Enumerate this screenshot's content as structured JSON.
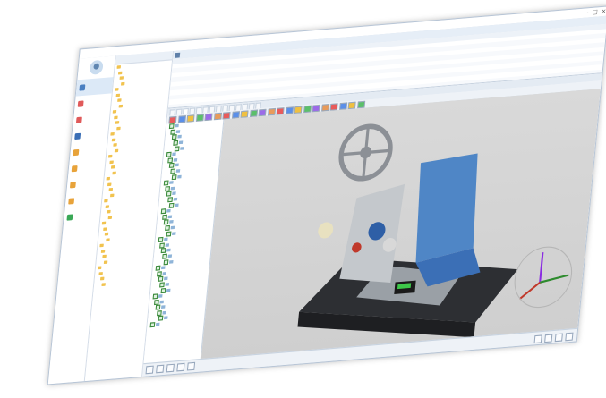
{
  "window": {
    "title": "",
    "controls": [
      "—",
      "□",
      "×"
    ]
  },
  "sidebar": {
    "items": [
      {
        "label": "",
        "icon": "document-icon",
        "color": "#4a7fc1"
      },
      {
        "label": "",
        "icon": "folder-icon",
        "color": "#e05a5a"
      },
      {
        "label": "",
        "icon": "folder-icon",
        "color": "#e05a5a"
      },
      {
        "label": "",
        "icon": "cube-icon",
        "color": "#3b6fb6"
      },
      {
        "label": "",
        "icon": "folder-icon",
        "color": "#e8a33a"
      },
      {
        "label": "",
        "icon": "folder-icon",
        "color": "#e8a33a"
      },
      {
        "label": "",
        "icon": "folder-icon",
        "color": "#e8a33a"
      },
      {
        "label": "",
        "icon": "folder-icon",
        "color": "#e8a33a"
      },
      {
        "label": "",
        "icon": "folder-icon",
        "color": "#3aa856"
      }
    ]
  },
  "tree": {
    "header": "",
    "rows": 40
  },
  "main": {
    "header": "",
    "grid": {
      "rows": 10,
      "cols": 12
    }
  },
  "viewer": {
    "tabs": [
      "",
      "",
      "",
      "",
      "",
      "",
      "",
      "",
      "",
      "",
      "",
      "",
      "",
      ""
    ],
    "toolbar_count": 22,
    "part_rows": 36
  },
  "footer": {
    "buttons": [
      "",
      "",
      "",
      "",
      ""
    ],
    "right_buttons": [
      "",
      "",
      "",
      ""
    ]
  },
  "colors": {
    "accent": "#3b6fb6",
    "background": "#f3f6fa",
    "model_blue": "#4f86c6",
    "model_dark": "#2d2f33"
  }
}
